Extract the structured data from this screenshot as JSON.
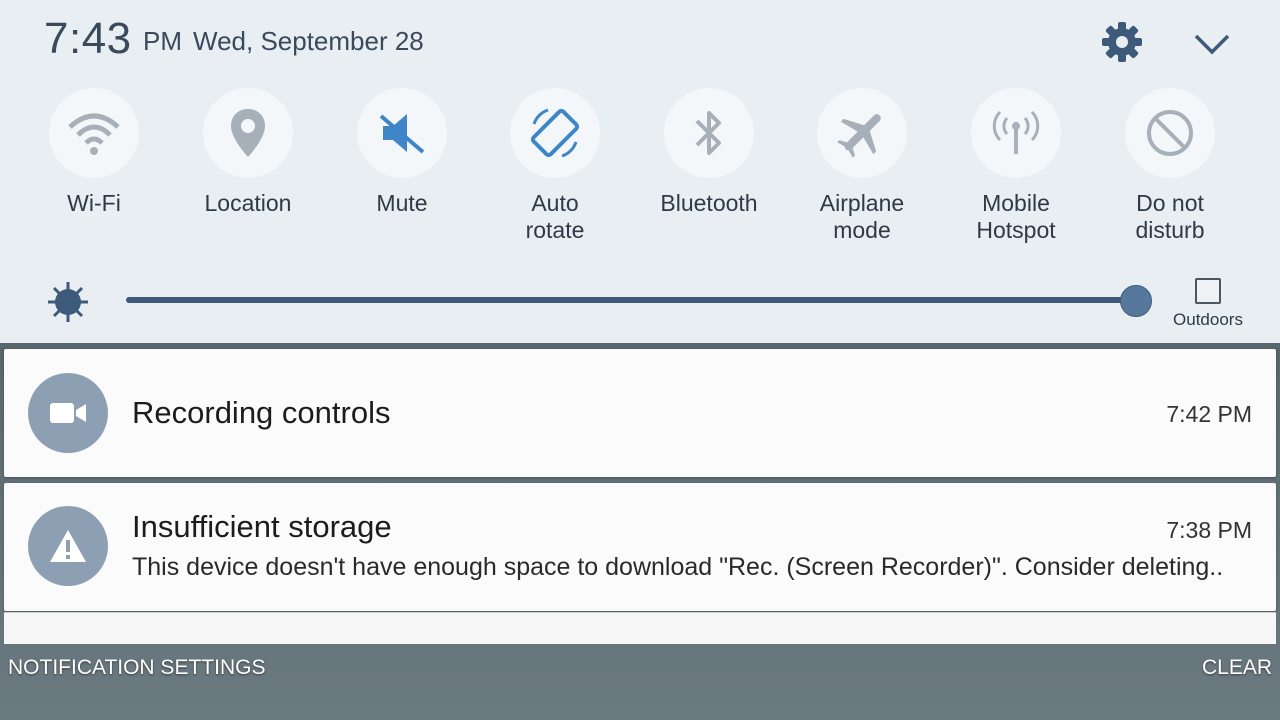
{
  "status": {
    "time": "7:43",
    "ampm": "PM",
    "date": "Wed, September 28"
  },
  "header": {
    "settings_icon": "gear-icon",
    "expand_icon": "chevron-down-icon"
  },
  "tiles": [
    {
      "label": "Wi-Fi",
      "icon": "wifi-icon"
    },
    {
      "label": "Location",
      "icon": "location-pin-icon"
    },
    {
      "label": "Mute",
      "icon": "mute-icon"
    },
    {
      "label": "Auto\nrotate",
      "icon": "auto-rotate-icon"
    },
    {
      "label": "Bluetooth",
      "icon": "bluetooth-icon"
    },
    {
      "label": "Airplane\nmode",
      "icon": "airplane-icon"
    },
    {
      "label": "Mobile\nHotspot",
      "icon": "hotspot-icon"
    },
    {
      "label": "Do not\ndisturb",
      "icon": "do-not-disturb-icon"
    }
  ],
  "brightness": {
    "level_fraction": 1.0,
    "outdoors_label": "Outdoors",
    "outdoors_checked": false
  },
  "notifications": [
    {
      "title": "Recording controls",
      "time": "7:42 PM",
      "body": "",
      "icon": "video-camera-icon"
    },
    {
      "title": "Insufficient storage",
      "time": "7:38 PM",
      "body": "This device doesn't have enough space to download \"Rec. (Screen Recorder)\". Consider deleting..",
      "icon": "warning-icon"
    }
  ],
  "footer": {
    "settings_label": "NOTIFICATION SETTINGS",
    "clear_label": "CLEAR"
  },
  "colors": {
    "accent": "#3d5a7a",
    "icon_active": "#3f86c8",
    "icon_inactive": "#a7b0b8",
    "shade_bg": "#e8eef2"
  }
}
